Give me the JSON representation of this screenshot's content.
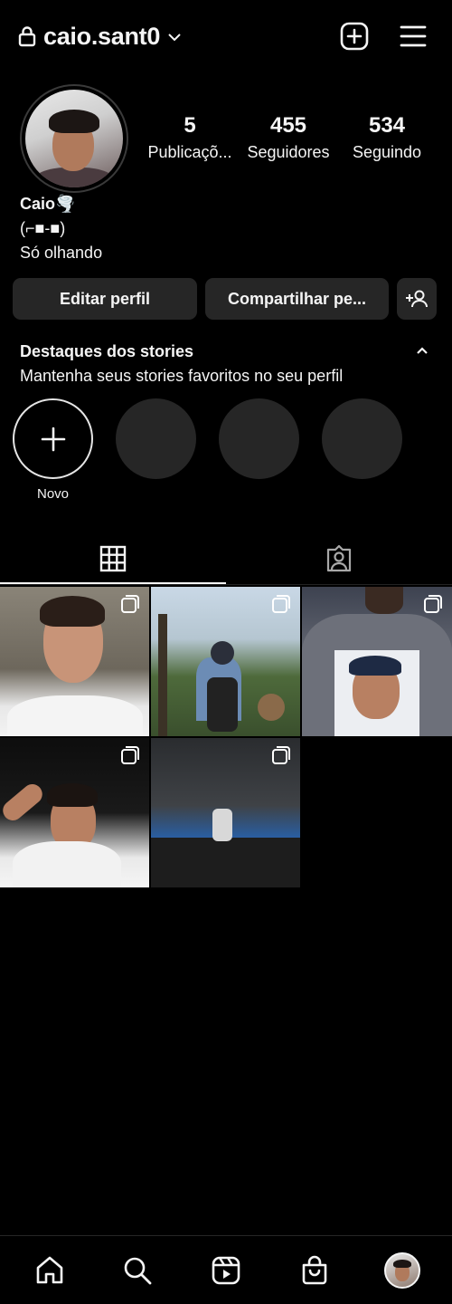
{
  "header": {
    "username": "caio.sant0",
    "icons": [
      "lock-icon",
      "chevron-down-icon",
      "add-post-icon",
      "menu-icon"
    ]
  },
  "profile": {
    "stats": [
      {
        "value": "5",
        "label": "Publicaçõ..."
      },
      {
        "value": "455",
        "label": "Seguidores"
      },
      {
        "value": "534",
        "label": "Seguindo"
      }
    ],
    "bio": {
      "name": "Caio🌪️",
      "line2": "(⌐■-■)",
      "line3": "Só olhando"
    }
  },
  "actions": {
    "edit_label": "Editar perfil",
    "share_label": "Compartilhar pe...",
    "add_person_icon": "add-person-icon"
  },
  "highlights": {
    "title": "Destaques dos stories",
    "subtitle": "Mantenha seus stories favoritos no seu perfil",
    "new_label": "Novo"
  },
  "tabs": [
    "grid-icon",
    "tagged-icon"
  ],
  "posts": [
    {
      "type": "carousel"
    },
    {
      "type": "carousel"
    },
    {
      "type": "carousel"
    },
    {
      "type": "carousel"
    },
    {
      "type": "carousel"
    }
  ],
  "bottom_nav": [
    "home-icon",
    "search-icon",
    "reels-icon",
    "shop-icon",
    "profile-avatar"
  ]
}
